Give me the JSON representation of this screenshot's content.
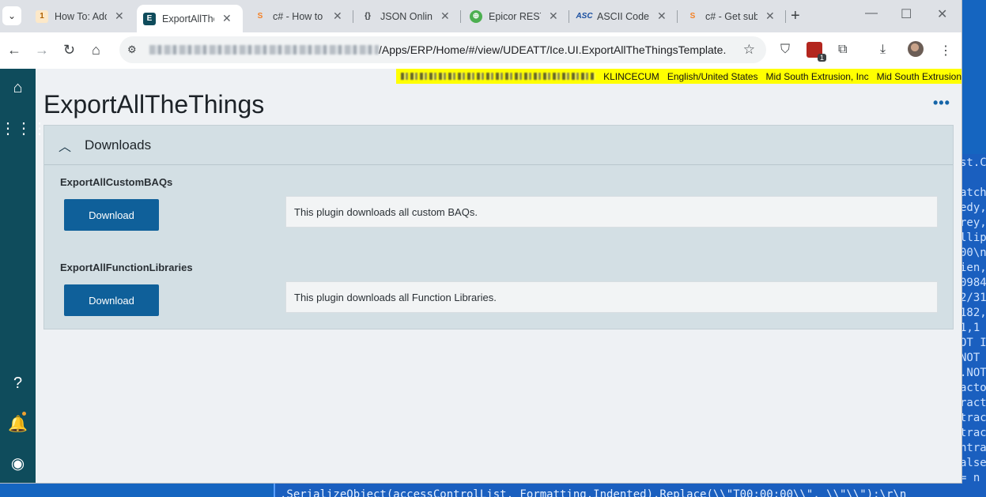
{
  "background_code": {
    "lines": [
      "st.C",
      "",
      "atch",
      "edy,",
      "rey,",
      "llip",
      "00\\n",
      "ien,",
      "0984",
      "2/31",
      "182,",
      "1,1",
      "OT I",
      "NOT",
      ".NOT",
      "acto",
      "ract",
      "trac",
      "trac",
      "ntra",
      "alse",
      "= n"
    ],
    "bottom_line": ".SerializeObject(accessControlList, Formatting.Indented).Replace(\\\\\"T00:00:00\\\\\", \\\\\"\\\\\"):\\r\\n"
  },
  "browser": {
    "tabs": [
      {
        "title": "How To: Add",
        "icon": "1",
        "icon_color": "#f0a030",
        "active": false
      },
      {
        "title": "ExportAllThe",
        "icon": "E",
        "icon_color": "#0f4c5c",
        "active": true
      },
      {
        "title": "c# - How to",
        "icon": "S",
        "icon_color": "#f48024",
        "active": false
      },
      {
        "title": "JSON Online",
        "icon": "{}",
        "icon_color": "#3c4043",
        "active": false
      },
      {
        "title": "Epicor REST",
        "icon": "⊕",
        "icon_color": "#4caf50",
        "active": false
      },
      {
        "title": "ASCII Code",
        "icon": "ASC",
        "icon_color": "#1a4fa0",
        "active": false
      },
      {
        "title": "c# - Get sub",
        "icon": "S",
        "icon_color": "#f48024",
        "active": false
      }
    ],
    "new_tab": "+",
    "url": "/Apps/ERP/Home/#/view/UDEATT/Ice.UI.ExportAllTheThingsTemplate..."
  },
  "app": {
    "userbar": {
      "user": "KLINCECUM",
      "language": "English/United States",
      "company": "Mid South Extrusion, Inc",
      "site": "Mid South Extrusion"
    },
    "title": "ExportAllTheThings",
    "more": "•••",
    "panel": {
      "title": "Downloads",
      "items": [
        {
          "label": "ExportAllCustomBAQs",
          "button": "Download",
          "description": "This plugin downloads all custom BAQs."
        },
        {
          "label": "ExportAllFunctionLibraries",
          "button": "Download",
          "description": "This plugin downloads all Function Libraries."
        }
      ]
    }
  },
  "colors": {
    "sidebar": "#0f4c5c",
    "button": "#0f609a",
    "userbar": "#ffff00"
  }
}
